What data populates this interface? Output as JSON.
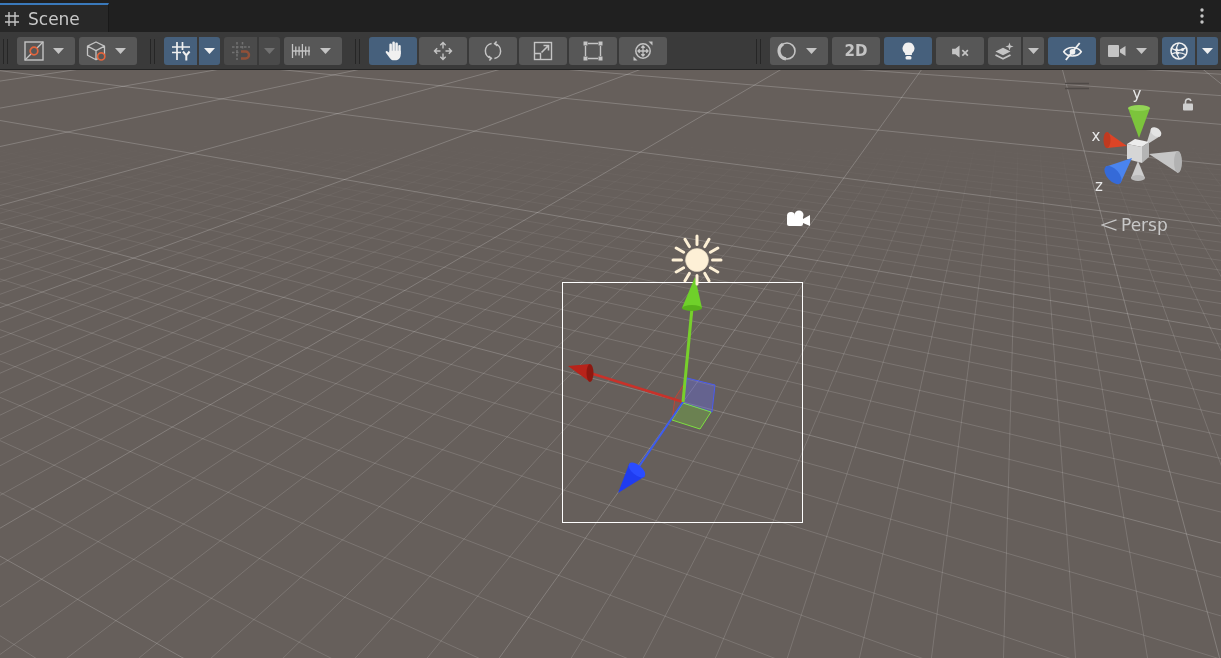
{
  "tabs": [
    {
      "label": "Scene",
      "selected": true
    }
  ],
  "toolbar": {
    "left_groups": [
      {
        "kind": "separate",
        "buttons": [
          {
            "kind": "dropdown"
          },
          {
            "kind": "dropdown"
          }
        ]
      },
      {
        "kind": "separate",
        "buttons": [
          {
            "kind": "split",
            "on": true,
            "disabled": false
          },
          {
            "kind": "split",
            "on": false,
            "disabled": true
          },
          {
            "kind": "dropdown",
            "disabled": false
          }
        ]
      },
      {
        "kind": "joined",
        "buttons": [
          {
            "kind": "toggle",
            "selected": true
          },
          {
            "kind": "toggle",
            "selected": false
          },
          {
            "kind": "toggle",
            "selected": false
          },
          {
            "kind": "toggle",
            "selected": false
          },
          {
            "kind": "toggle",
            "selected": false
          },
          {
            "kind": "toggle",
            "selected": false
          }
        ]
      }
    ],
    "right_groups": [
      {
        "kind": "separate",
        "buttons": [
          {
            "kind": "dropdown"
          },
          {
            "kind": "text",
            "label": "2D",
            "on": false
          },
          {
            "kind": "toggle",
            "on": true
          },
          {
            "kind": "toggle",
            "on": false
          },
          {
            "kind": "split",
            "on": false
          },
          {
            "kind": "toggle",
            "on": true
          },
          {
            "kind": "dropdown"
          },
          {
            "kind": "split",
            "on": true
          }
        ]
      }
    ]
  },
  "scene": {
    "orientation_gizmo": {
      "axis_labels": [
        "y",
        "x",
        "z"
      ],
      "projection": "Persp"
    }
  }
}
